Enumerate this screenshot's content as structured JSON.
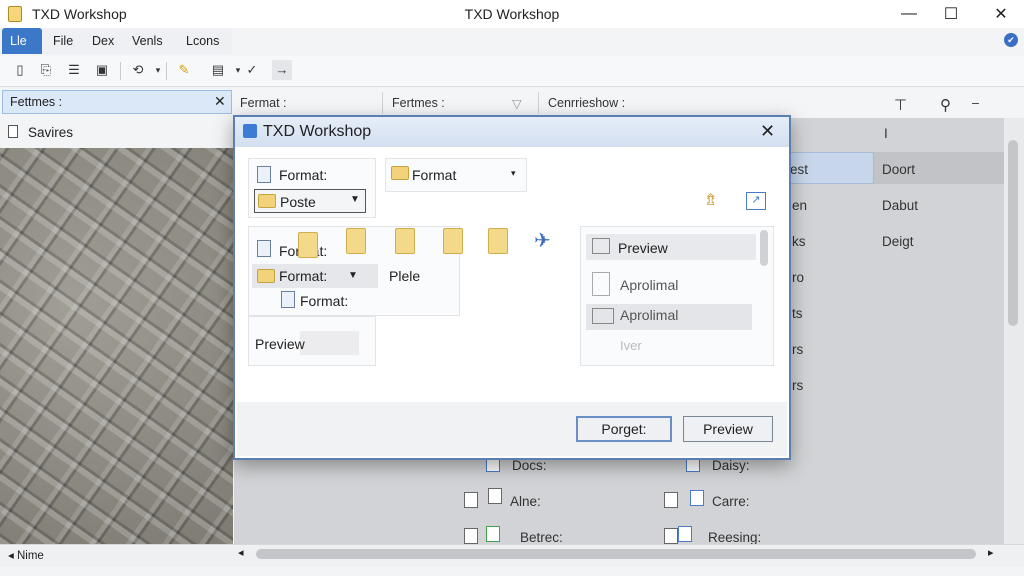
{
  "window": {
    "app_title": "TXD Workshop",
    "center_title": "TXD Workshop",
    "minimize": "—",
    "maximize": "☐",
    "close": "✕"
  },
  "menu": {
    "items": [
      "Lle",
      "File",
      "Dex",
      "Venls",
      "Lcons"
    ]
  },
  "help_icon": "help-icon",
  "toolbar": {
    "icons": [
      "new-file-icon",
      "copy-icon",
      "list-icon",
      "save-icon",
      "link-icon",
      "edit-icon",
      "properties-icon",
      "check-icon",
      "forward-icon"
    ]
  },
  "left_pane": {
    "header": "Fettmes :",
    "close": "✕",
    "row_label": "Savires"
  },
  "columns": {
    "col1": "Fermat :",
    "col2": "Fertmes :",
    "col3": "Cenrrieshow :"
  },
  "list": {
    "right_col_header": "I",
    "selected_cell": "est",
    "rows_right": [
      "Doort",
      "Dabut",
      "Deigt"
    ],
    "row_fragments": [
      "en",
      "ks",
      "ro",
      "ts",
      "rs",
      "rs"
    ],
    "bottom_left": [
      "Docs:",
      "Alne:",
      "Betrec:"
    ],
    "bottom_right": [
      "Daisy:",
      "Carre:",
      "Reesing:"
    ]
  },
  "status": {
    "left": "◂  Nime"
  },
  "dialog": {
    "title": "TXD Workshop",
    "close": "✕",
    "format_label_1": "Format:",
    "dropdown_value": "Poste",
    "format_dropdown_2": "Format",
    "format_label_2": "Format:",
    "format_dropdown_3": "Format:",
    "format_label_3": "Format:",
    "plele": "Plele",
    "preview_left": "Preview",
    "preview_list": [
      "Preview",
      "Aprolimal",
      "Aprolimal",
      "Iver"
    ],
    "button_primary": "Porget:",
    "button_secondary": "Preview"
  },
  "colors": {
    "accent": "#3b78c8",
    "dialog_border": "#5a7fb0",
    "selection": "#c7d6ea"
  }
}
